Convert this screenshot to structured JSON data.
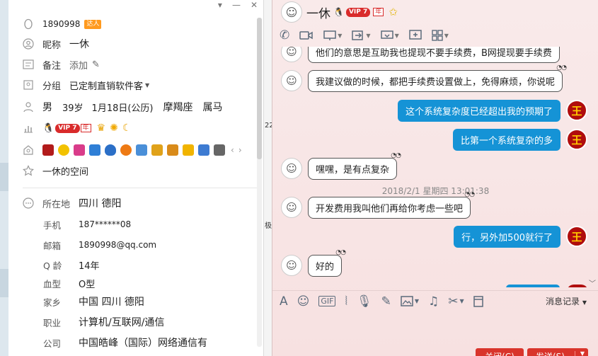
{
  "window_controls": [
    "▾",
    "—",
    "✕"
  ],
  "profile": {
    "qq_number": "1890998",
    "talent_badge": "达人",
    "nickname_label": "昵称",
    "nickname": "一休",
    "remark_label": "备注",
    "remark_placeholder": "添加",
    "group_label": "分组",
    "group_value": "已定制直销软件客",
    "gender": "男",
    "age": "39岁",
    "birthday": "1月18日(公历)",
    "constellation": "摩羯座",
    "zodiac": "属马",
    "vip_text": "VIP 7",
    "vip_year": "年",
    "space_label": "一休的空间",
    "location_label": "所在地",
    "location": "四川 德阳",
    "phone_label": "手机",
    "phone": "187******08",
    "email_label": "邮箱",
    "email": "1890998@qq.com",
    "qage_label": "Q 龄",
    "qage": "14年",
    "blood_label": "血型",
    "blood": "O型",
    "hometown_label": "家乡",
    "hometown": "中国 四川 德阳",
    "job_label": "职业",
    "job": "计算机/互联网/通信",
    "company_label": "公司",
    "company": "中国皓峰（国际）网络通信有"
  },
  "background_window": {
    "text_22": "22",
    "text_ni": "极"
  },
  "chat": {
    "contact_name": "一休",
    "vip_text": "VIP 7",
    "vip_year": "年",
    "messages": [
      {
        "side": "left",
        "text": "他们的意思是互助我也提现不要手续费，B网提现要手续费"
      },
      {
        "side": "left",
        "text": "我建议做的时候，都把手续费设置做上，免得麻烦，你说呢"
      },
      {
        "side": "right",
        "text": "这个系统复杂度已经超出我的预期了"
      },
      {
        "side": "right",
        "text": "比第一个系统复杂的多"
      },
      {
        "side": "left",
        "text": "嘿嘿，是有点复杂"
      },
      {
        "side": "left",
        "text": "开发费用我叫他们再给你考虑一些吧"
      },
      {
        "side": "right",
        "text": "行，另外加500就行了"
      },
      {
        "side": "left",
        "text": "好的"
      }
    ],
    "timestamp": "2018/2/1 星期四 13:01:38",
    "history_label": "消息记录",
    "close_label": "关闭(C)",
    "send_label": "发送(S)",
    "right_avatar_char": "王"
  }
}
